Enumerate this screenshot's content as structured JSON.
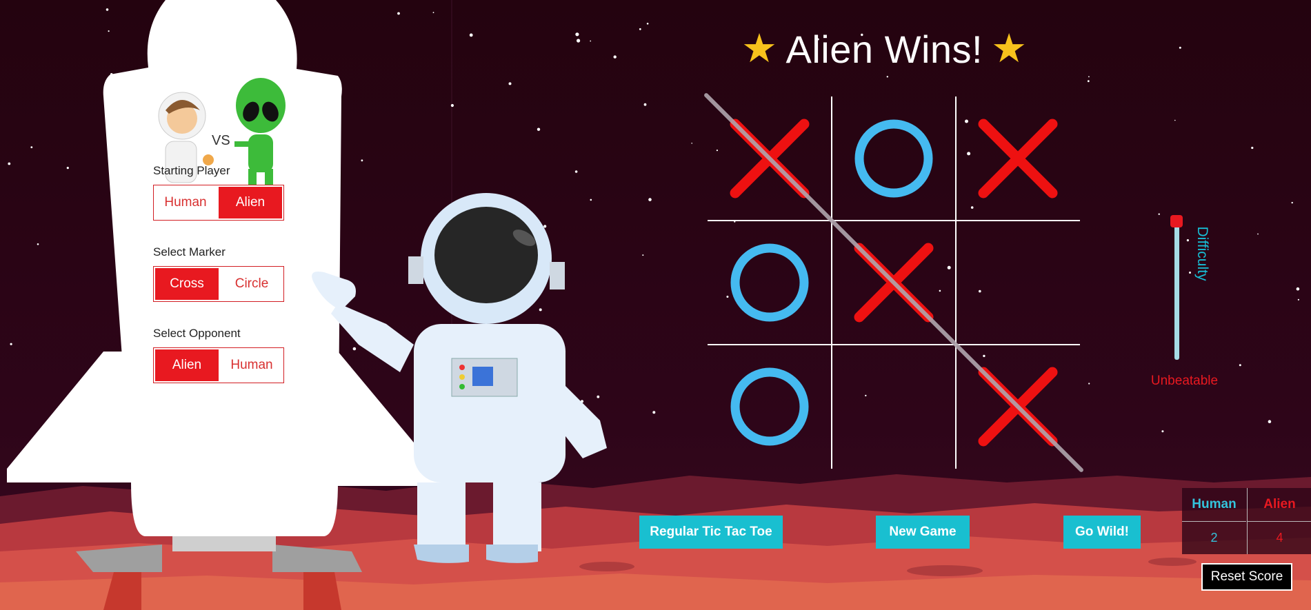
{
  "header": {
    "title": "Alien Wins!",
    "star_left": "★",
    "star_right": "★"
  },
  "setup": {
    "vs_text": "VS",
    "starting_player": {
      "label": "Starting Player",
      "options": [
        "Human",
        "Alien"
      ],
      "selected": "Alien"
    },
    "marker": {
      "label": "Select Marker",
      "options": [
        "Cross",
        "Circle"
      ],
      "selected": "Cross"
    },
    "opponent": {
      "label": "Select Opponent",
      "options": [
        "Alien",
        "Human"
      ],
      "selected": "Alien"
    }
  },
  "board": {
    "cells": [
      "X",
      "O",
      "X",
      "O",
      "X",
      "",
      "O",
      "",
      "X"
    ],
    "winning_line": [
      0,
      4,
      8
    ],
    "colors": {
      "cross": "#ee1111",
      "circle": "#45baf0",
      "grid": "#ffffff",
      "strike": "#b0a6ae"
    }
  },
  "difficulty": {
    "label": "Difficulty",
    "level": "Unbeatable",
    "value_fraction": 1.0
  },
  "buttons": {
    "regular": "Regular Tic Tac Toe",
    "new_game": "New Game",
    "wild": "Go Wild!",
    "reset": "Reset Score"
  },
  "score": {
    "human_label": "Human",
    "alien_label": "Alien",
    "human": 2,
    "alien": 4
  },
  "colors": {
    "accent_red": "#e81920",
    "accent_cyan": "#19bfd0",
    "sky": "#2a0418",
    "mars": "#d4504a"
  }
}
